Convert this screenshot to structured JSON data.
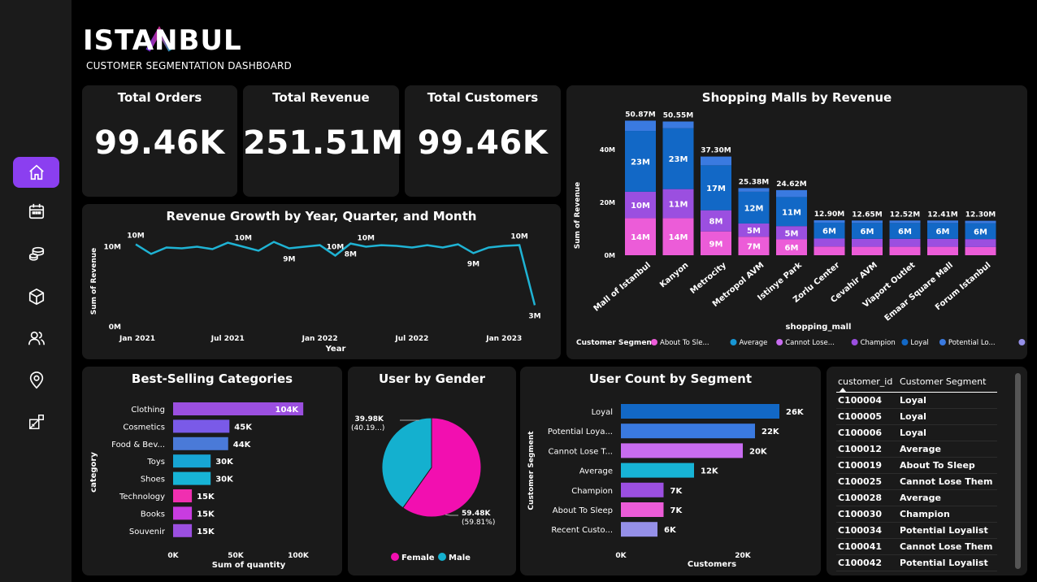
{
  "brand": {
    "logo_text": "ISTANBUL",
    "subtitle": "CUSTOMER SEGMENTATION DASHBOARD"
  },
  "nav": [
    {
      "name": "home",
      "icon": "home-icon",
      "active": true
    },
    {
      "name": "calendar",
      "icon": "calendar-icon"
    },
    {
      "name": "coins",
      "icon": "coins-icon"
    },
    {
      "name": "box",
      "icon": "box-icon"
    },
    {
      "name": "users",
      "icon": "users-icon"
    },
    {
      "name": "location",
      "icon": "location-pin-icon"
    },
    {
      "name": "shapes",
      "icon": "shapes-icon"
    }
  ],
  "kpis": {
    "orders": {
      "title": "Total Orders",
      "value": "99.46K"
    },
    "revenue": {
      "title": "Total Revenue",
      "value": "251.51M"
    },
    "customers": {
      "title": "Total Customers",
      "value": "99.46K"
    }
  },
  "colors": {
    "panel": "#1a1a1a",
    "line": "#1fb3d4",
    "purple": "#8b3ff0",
    "About To Sleep": "#ec5cd8",
    "Average": "#1796d4",
    "Cannot Lose Them": "#c86cf0",
    "Champion": "#9b4fe0",
    "Loyal": "#1268c6",
    "Potential Loyalist": "#3a7ae0",
    "Recent Customers": "#9590e8"
  },
  "chart_data": [
    {
      "id": "malls",
      "type": "bar",
      "title": "Shopping Malls by Revenue",
      "xlabel": "shopping_mall",
      "ylabel": "Sum of Revenue",
      "ylim": [
        0,
        55
      ],
      "yticks": [
        "0M",
        "20M",
        "40M"
      ],
      "categories": [
        "Mall of Istanbul",
        "Kanyon",
        "Metrocity",
        "Metropol AVM",
        "Istinye Park",
        "Zorlu Center",
        "Cevahir AVM",
        "Viaport Outlet",
        "Emaar Square Mall",
        "Forum Istanbul"
      ],
      "totals": [
        50.87,
        50.55,
        37.3,
        25.38,
        24.62,
        12.9,
        12.65,
        12.52,
        12.41,
        12.3
      ],
      "total_labels": [
        "50.87M",
        "50.55M",
        "37.30M",
        "25.38M",
        "24.62M",
        "12.90M",
        "12.65M",
        "12.52M",
        "12.41M",
        "12.30M"
      ],
      "stack_values": [
        [
          14,
          10,
          23
        ],
        [
          14,
          11,
          23
        ],
        [
          9,
          8,
          17
        ],
        [
          7,
          5,
          12
        ],
        [
          6,
          5,
          11
        ],
        [
          3.3,
          3,
          6
        ],
        [
          3.2,
          3,
          6
        ],
        [
          3.2,
          3,
          6
        ],
        [
          3.2,
          3,
          6
        ],
        [
          3.1,
          3,
          6
        ]
      ],
      "stack_labels": [
        [
          "14M",
          "10M",
          "23M"
        ],
        [
          "14M",
          "11M",
          "23M"
        ],
        [
          "9M",
          "8M",
          "17M"
        ],
        [
          "7M",
          "5M",
          "12M"
        ],
        [
          "6M",
          "5M",
          "11M"
        ],
        [
          "",
          "",
          "6M"
        ],
        [
          "",
          "",
          "6M"
        ],
        [
          "",
          "",
          "6M"
        ],
        [
          "",
          "",
          "6M"
        ],
        [
          "",
          "",
          "6M"
        ]
      ],
      "legend_title": "Customer Segment",
      "legend": [
        "About To Sle...",
        "Average",
        "Cannot Lose...",
        "Champion",
        "Loyal",
        "Potential Lo...",
        "Recent Cust..."
      ],
      "legend_keys": [
        "About To Sleep",
        "Average",
        "Cannot Lose Them",
        "Champion",
        "Loyal",
        "Potential Loyalist",
        "Recent Customers"
      ]
    },
    {
      "id": "growth",
      "type": "line",
      "title": "Revenue Growth by Year, Quarter, and Month",
      "xlabel": "Year",
      "ylabel": "Sum of Revenue",
      "x": [
        "2021-01",
        "2021-02",
        "2021-03",
        "2021-04",
        "2021-05",
        "2021-06",
        "2021-07",
        "2021-08",
        "2021-09",
        "2021-10",
        "2021-11",
        "2021-12",
        "2022-01",
        "2022-02",
        "2022-03",
        "2022-04",
        "2022-05",
        "2022-06",
        "2022-07",
        "2022-08",
        "2022-09",
        "2022-10",
        "2022-11",
        "2022-12",
        "2023-01",
        "2023-02",
        "2023-03"
      ],
      "values": [
        10.2,
        9.0,
        9.8,
        9.7,
        9.9,
        9.6,
        10.4,
        9.9,
        9.4,
        10.5,
        9.7,
        9.9,
        10.1,
        8.8,
        10.3,
        9.9,
        10.1,
        10.0,
        9.8,
        10.1,
        9.8,
        10.2,
        9.1,
        9.8,
        10.0,
        10.1,
        2.6
      ],
      "ylim": [
        0,
        13
      ],
      "yticks": [
        "0M",
        "10M"
      ],
      "xticks": [
        "Jan 2021",
        "Jul 2021",
        "Jan 2022",
        "Jul 2022",
        "Jan 2023"
      ],
      "point_labels": [
        {
          "i": 0,
          "text": "10M",
          "pos": "above"
        },
        {
          "i": 7,
          "text": "10M",
          "pos": "above"
        },
        {
          "i": 10,
          "text": "9M",
          "pos": "below"
        },
        {
          "i": 13,
          "text": "10M",
          "pos": "above"
        },
        {
          "i": 14,
          "text": "8M",
          "pos": "below"
        },
        {
          "i": 15,
          "text": "10M",
          "pos": "above"
        },
        {
          "i": 22,
          "text": "9M",
          "pos": "below"
        },
        {
          "i": 25,
          "text": "10M",
          "pos": "above"
        },
        {
          "i": 26,
          "text": "3M",
          "pos": "below"
        }
      ]
    },
    {
      "id": "categories",
      "type": "bar",
      "title": "Best-Selling Categories",
      "xlabel": "Sum of quantity",
      "ylabel": "category",
      "categories": [
        "Clothing",
        "Cosmetics",
        "Food & Bev...",
        "Toys",
        "Shoes",
        "Technology",
        "Books",
        "Souvenir"
      ],
      "values": [
        104,
        45,
        44,
        30,
        30,
        15,
        15,
        15
      ],
      "labels": [
        "104K",
        "45K",
        "44K",
        "30K",
        "30K",
        "15K",
        "15K",
        "15K"
      ],
      "colors": [
        "#9b4fe0",
        "#7a5ae8",
        "#4a7ad8",
        "#17a5d4",
        "#17b4d6",
        "#f02fb0",
        "#c83ce0",
        "#9b4fe0"
      ],
      "xlim": [
        0,
        100
      ],
      "xticks": [
        "0K",
        "50K",
        "100K"
      ]
    },
    {
      "id": "gender",
      "type": "pie",
      "title": "User by Gender",
      "slices": [
        {
          "name": "Female",
          "value": 59.81,
          "label": "59.48K",
          "pct": "(59.81%)",
          "color": "#f20fb0"
        },
        {
          "name": "Male",
          "value": 40.19,
          "label": "39.98K",
          "pct": "(40.19...)",
          "color": "#14b0cf"
        }
      ]
    },
    {
      "id": "segments",
      "type": "bar",
      "title": "User Count by Segment",
      "xlabel": "Customers",
      "ylabel": "Customer Segment",
      "categories": [
        "Loyal",
        "Potential Loya...",
        "Cannot Lose T...",
        "Average",
        "Champion",
        "About To Sleep",
        "Recent Custo..."
      ],
      "values": [
        26,
        22,
        20,
        12,
        7,
        7,
        6
      ],
      "labels": [
        "26K",
        "22K",
        "20K",
        "12K",
        "7K",
        "7K",
        "6K"
      ],
      "colors": [
        "#1268c6",
        "#3a7ae0",
        "#c86cf0",
        "#17b4d6",
        "#9b4fe0",
        "#ec5cd8",
        "#9590e8"
      ],
      "xlim": [
        0,
        30
      ],
      "xticks": [
        "0K",
        "20K"
      ]
    }
  ],
  "table": {
    "headers": [
      "customer_id",
      "Customer Segment"
    ],
    "rows": [
      [
        "C100004",
        "Loyal"
      ],
      [
        "C100005",
        "Loyal"
      ],
      [
        "C100006",
        "Loyal"
      ],
      [
        "C100012",
        "Average"
      ],
      [
        "C100019",
        "About To Sleep"
      ],
      [
        "C100025",
        "Cannot Lose Them"
      ],
      [
        "C100028",
        "Average"
      ],
      [
        "C100030",
        "Champion"
      ],
      [
        "C100034",
        "Potential Loyalist"
      ],
      [
        "C100041",
        "Cannot Lose Them"
      ],
      [
        "C100042",
        "Potential Loyalist"
      ]
    ]
  }
}
